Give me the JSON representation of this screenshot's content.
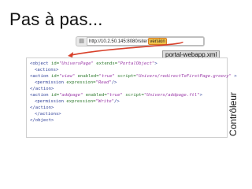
{
  "slide": {
    "title": "Pas à pas...",
    "side_label": "Contrôleur"
  },
  "browser": {
    "url_prefix": "http://10.2.50.145:8080/site/",
    "url_highlight": "version"
  },
  "file_label": "portal-webapp.xml",
  "code": {
    "line1": {
      "a": "<object ",
      "b": "id=",
      "c": "\"UniversPage\"",
      "d": " extends=",
      "e": "\"PortalObject\"",
      "f": ">"
    },
    "line2": "<actions>",
    "line3": {
      "a": "<action ",
      "b": "id=",
      "c": "\"view\"",
      "d": " enabled=",
      "e": "\"true\"",
      "f": " script=",
      "g": "\"Univers/redirectToFirstPage.groovy\"",
      "h": " >"
    },
    "line4": {
      "a": "<permission ",
      "b": "expression=",
      "c": "\"Read\"",
      "d": "/>"
    },
    "line5": "</action>",
    "line6": {
      "a": "<action ",
      "b": "id=",
      "c": "\"addpage\"",
      "d": " enabled=",
      "e": "\"true\"",
      "f": " script=",
      "g": "\"Univers/addpage.ftl\"",
      "h": ">"
    },
    "line7": {
      "a": "<permission ",
      "b": "expression=",
      "c": "\"Write\"",
      "d": "/>"
    },
    "line8": "</action>",
    "line9": "</actions>",
    "line10": "</object>"
  },
  "colors": {
    "arrow": "#d8402a",
    "highlight": "#f2c24a"
  },
  "icons": {
    "bar_icon": "page-icon"
  }
}
